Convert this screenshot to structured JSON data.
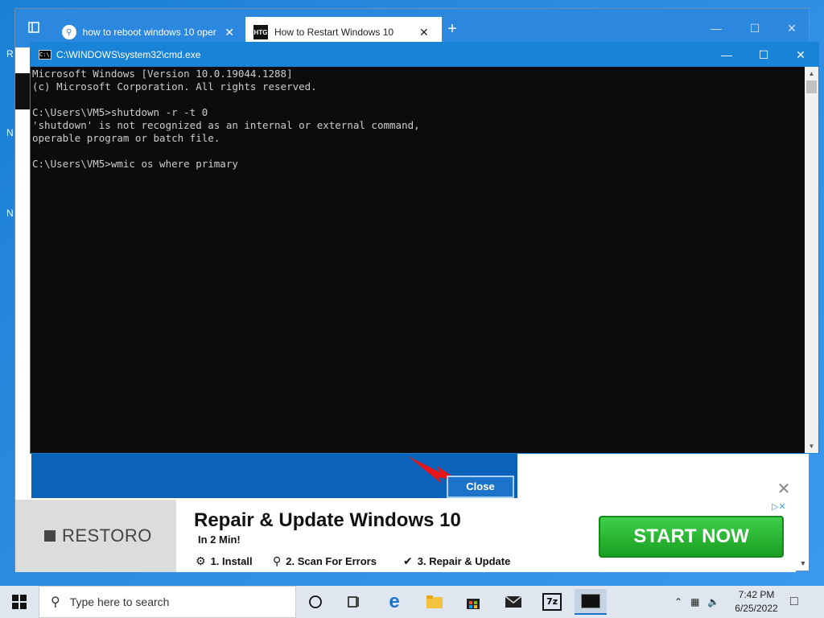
{
  "desktop": {
    "letters": [
      "R",
      "N",
      "N"
    ]
  },
  "browser": {
    "tabs": [
      {
        "label": "how to reboot windows 10 oper",
        "icon": "search-icon",
        "active": false
      },
      {
        "label": "How to Restart Windows 10",
        "icon": "htg-icon",
        "active": true
      }
    ],
    "new_tab": "+",
    "tab_close": "✕",
    "page": {
      "close_button": "Close",
      "ad": {
        "brand": "RESTORO",
        "title": "Repair & Update Windows 10",
        "subtitle": "In 2 Min!",
        "steps": [
          {
            "icon": "gear-icon",
            "label": "1. Install"
          },
          {
            "icon": "search-icon",
            "label": "2. Scan For Errors"
          },
          {
            "icon": "check-icon",
            "label": "3. Repair & Update"
          }
        ],
        "cta": "START NOW",
        "badge": "▷✕"
      }
    }
  },
  "cmd": {
    "title": "C:\\WINDOWS\\system32\\cmd.exe",
    "lines": [
      "Microsoft Windows [Version 10.0.19044.1288]",
      "(c) Microsoft Corporation. All rights reserved.",
      "",
      "C:\\Users\\VM5>shutdown -r -t 0",
      "'shutdown' is not recognized as an internal or external command,",
      "operable program or batch file.",
      "",
      "C:\\Users\\VM5>wmic os where primary"
    ]
  },
  "taskbar": {
    "search_placeholder": "Type here to search",
    "time": "7:42 PM",
    "date": "6/25/2022",
    "icons": [
      "task-view-icon",
      "timeline-icon",
      "edge-icon",
      "file-explorer-icon",
      "store-icon",
      "mail-icon",
      "7zip-icon",
      "cmd-icon"
    ],
    "zip_label": "7z"
  }
}
